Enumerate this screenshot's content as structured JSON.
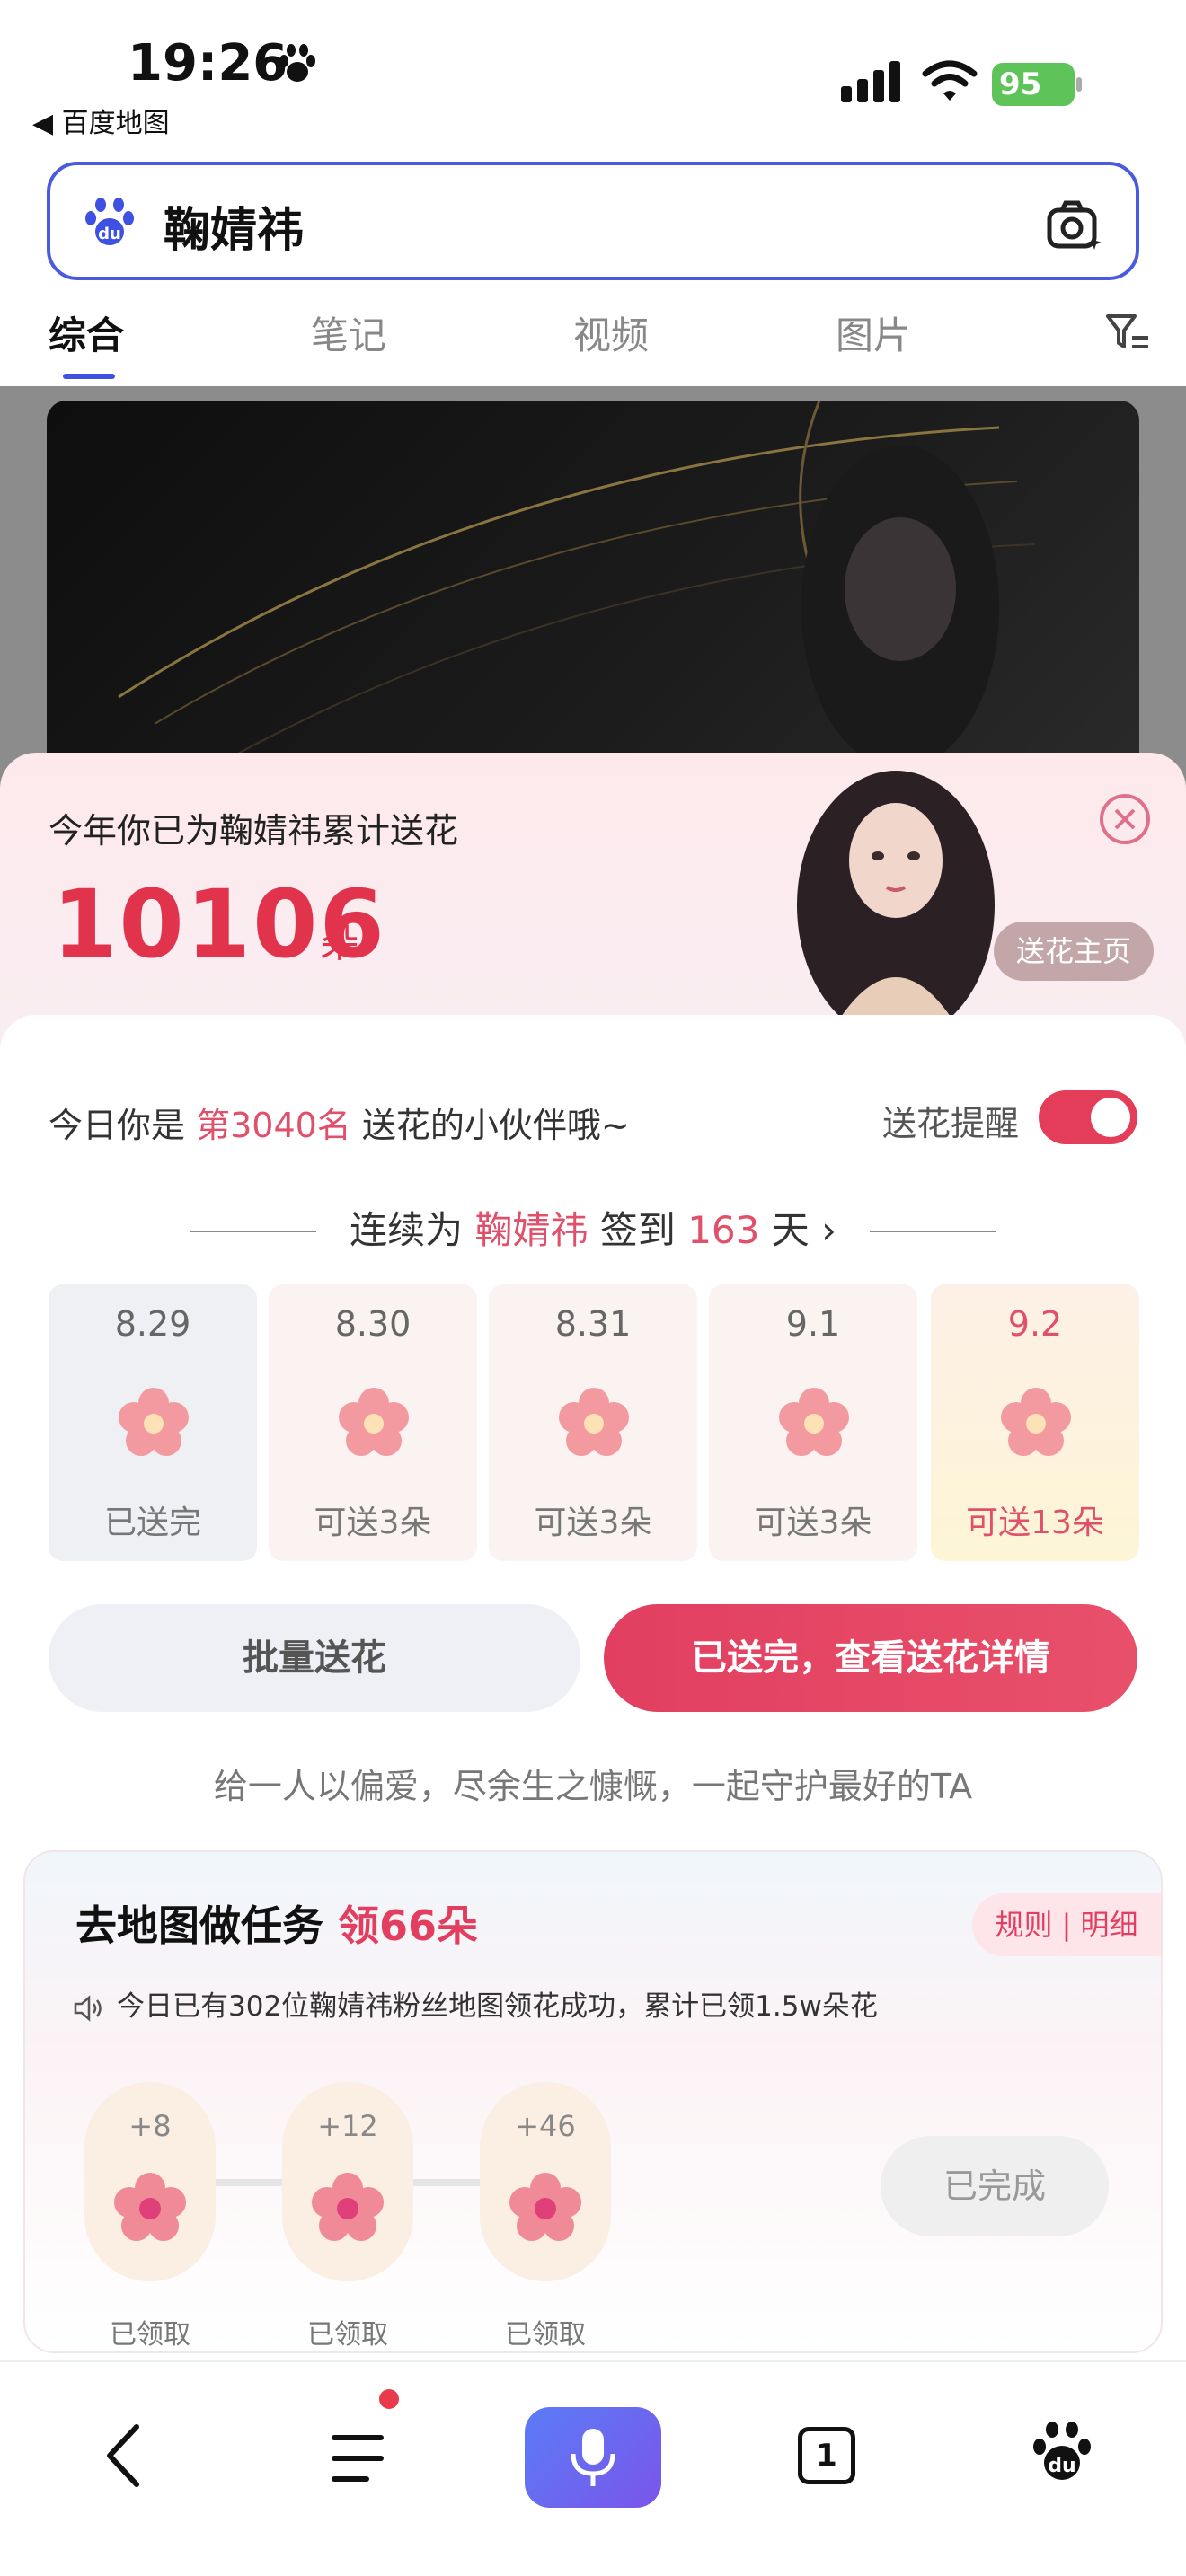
{
  "status_bar": {
    "time": "19:26",
    "back_app": "◀ 百度地图",
    "battery": "95"
  },
  "search": {
    "query": "鞠婧祎"
  },
  "tabs": [
    {
      "label": "综合",
      "active": true
    },
    {
      "label": "笔记",
      "active": false
    },
    {
      "label": "视频",
      "active": false
    },
    {
      "label": "图片",
      "active": false
    }
  ],
  "panel": {
    "header": "今年你已为鞠婧祎累计送花",
    "count": "10106",
    "count_unit": "朵",
    "home_button": "送花主页",
    "rank_prefix": "今日你是 ",
    "rank_value": "第3040名",
    "rank_suffix": " 送花的小伙伴哦~",
    "remind_label": "送花提醒",
    "remind_on": true,
    "streak_prefix": "连续为 ",
    "streak_name": "鞠婧祎",
    "streak_mid": " 签到 ",
    "streak_days": "163",
    "streak_suffix": " 天 ›",
    "days": [
      {
        "date": "8.29",
        "status": "已送完"
      },
      {
        "date": "8.30",
        "status": "可送3朵"
      },
      {
        "date": "8.31",
        "status": "可送3朵"
      },
      {
        "date": "9.1",
        "status": "可送3朵"
      },
      {
        "date": "9.2",
        "status": "可送13朵"
      }
    ],
    "batch_button": "批量送花",
    "detail_button": "已送完，查看送花详情",
    "slogan": "给一人以偏爱，尽余生之慷慨，一起守护最好的TA"
  },
  "task": {
    "title_prefix": "去地图做任务 ",
    "title_highlight": "领66朵",
    "rule_links": "规则 | 明细",
    "notice": "今日已有302位鞠婧祎粉丝地图领花成功，累计已领1.5w朵花",
    "rewards": [
      {
        "amount": "+8",
        "label": "已领取"
      },
      {
        "amount": "+12",
        "label": "已领取"
      },
      {
        "amount": "+46",
        "label": "已领取"
      }
    ],
    "done_button": "已完成"
  },
  "bottom_nav": {
    "tab_count": "1"
  },
  "colors": {
    "accent": "#e23f60",
    "brand_blue": "#3f51e0"
  }
}
